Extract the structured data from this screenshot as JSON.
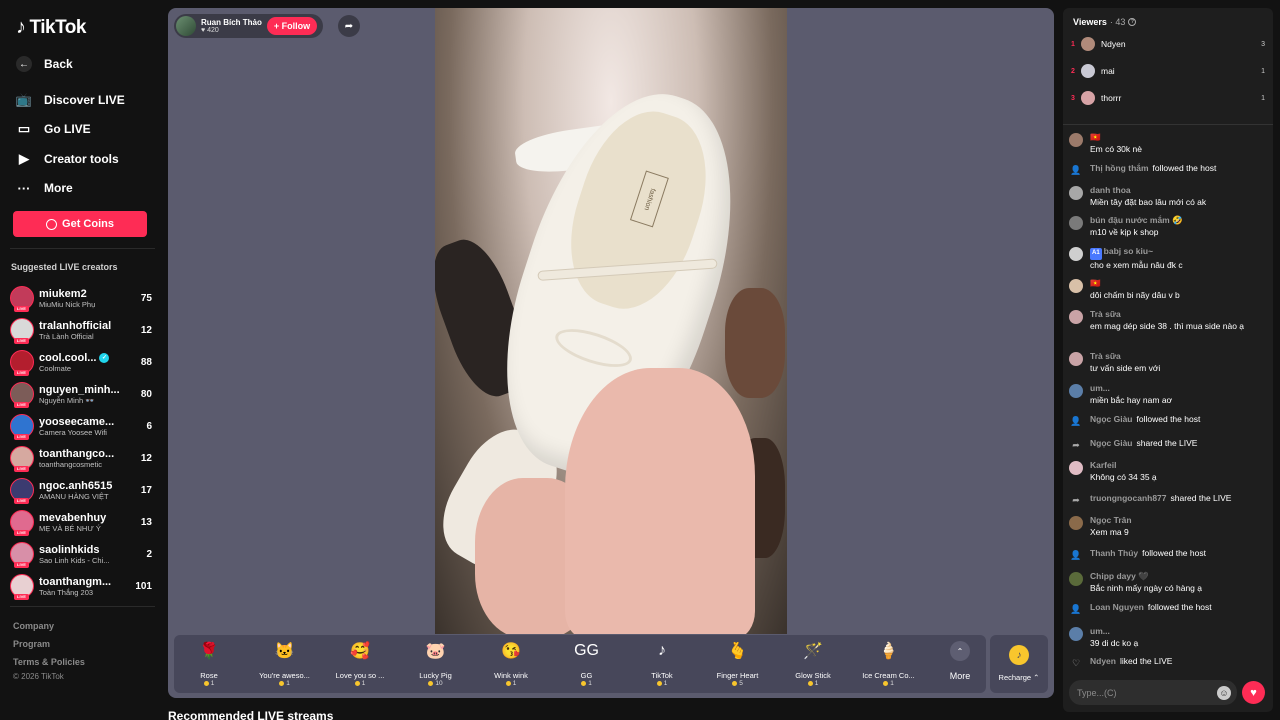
{
  "brand": {
    "logo_text": "TikTok"
  },
  "nav": {
    "back": "Back",
    "discover": "Discover LIVE",
    "go_live": "Go LIVE",
    "creator_tools": "Creator tools",
    "more": "More",
    "get_coins": "Get Coins"
  },
  "suggested": {
    "title": "Suggested LIVE creators",
    "creators": [
      {
        "name": "miukem2",
        "sub": "MiuMiu Nick Phụ",
        "count": "75",
        "color": "#c23b5a"
      },
      {
        "name": "tralanhofficial",
        "sub": "Trà Lành Official",
        "count": "12",
        "color": "#d9d9d9"
      },
      {
        "name": "cool.cool...",
        "sub": "Coolmate",
        "count": "88",
        "color": "#b31e2e",
        "verified": true
      },
      {
        "name": "nguyen_minh...",
        "sub": "Nguyễn Minh 👓",
        "count": "80",
        "color": "#7c5c58"
      },
      {
        "name": "yooseecame...",
        "sub": "Camera Yoosee Wifi",
        "count": "6",
        "color": "#2f74d0"
      },
      {
        "name": "toanthangco...",
        "sub": "toanthangcosmetic",
        "count": "12",
        "color": "#d6a9a0"
      },
      {
        "name": "ngoc.anh6515",
        "sub": "AMANU HÀNG VIỆT",
        "count": "17",
        "color": "#3b3b70"
      },
      {
        "name": "mevabenhuy",
        "sub": "MẸ VÀ BÉ NHƯ Ý",
        "count": "13",
        "color": "#e06a8f"
      },
      {
        "name": "saolinhkids",
        "sub": "Sao Linh Kids - Chi...",
        "count": "2",
        "color": "#d88fa8"
      },
      {
        "name": "toanthangm...",
        "sub": "Toàn Thắng 203",
        "count": "101",
        "color": "#e8d0d2"
      }
    ]
  },
  "footer": {
    "company": "Company",
    "program": "Program",
    "terms": "Terms & Policies",
    "copyright": "© 2026 TikTok"
  },
  "stream": {
    "host_name": "Ruan Bích Thảo",
    "host_likes": "420",
    "follow_label": "+ Follow",
    "brand_on_insole": "fashion"
  },
  "gifts": [
    {
      "name": "Rose",
      "price": "1",
      "icon": "🌹"
    },
    {
      "name": "You're aweso...",
      "price": "1",
      "icon": "🐱"
    },
    {
      "name": "Love you so ...",
      "price": "1",
      "icon": "🥰"
    },
    {
      "name": "Lucky Pig",
      "price": "10",
      "icon": "🐷"
    },
    {
      "name": "Wink wink",
      "price": "1",
      "icon": "😘"
    },
    {
      "name": "GG",
      "price": "1",
      "icon": "GG"
    },
    {
      "name": "TikTok",
      "price": "1",
      "icon": "♪"
    },
    {
      "name": "Finger Heart",
      "price": "5",
      "icon": "🫰"
    },
    {
      "name": "Glow Stick",
      "price": "1",
      "icon": "🪄"
    },
    {
      "name": "Ice Cream Co...",
      "price": "1",
      "icon": "🍦"
    }
  ],
  "gift_more": "More",
  "recharge": "Recharge",
  "recommended_title": "Recommended LIVE streams",
  "viewers": {
    "title": "Viewers",
    "count": "· 43",
    "top": [
      {
        "rank": "1",
        "name": "Ndyen",
        "score": "3",
        "color": "#b08a7a"
      },
      {
        "rank": "2",
        "name": "mai",
        "score": "1",
        "color": "#c9c9d4"
      },
      {
        "rank": "3",
        "name": "thorrr",
        "score": "1",
        "color": "#d7a3a6"
      }
    ]
  },
  "messages": [
    {
      "type": "chat",
      "user": "🇻🇳",
      "text": "Em có 30k nè",
      "color": "#9b7a6a"
    },
    {
      "type": "follow",
      "user": "Thị hồng thắm",
      "text": "followed the host"
    },
    {
      "type": "chat",
      "user": "danh thoa",
      "text": "Miền tây đặt bao lâu mới có ak",
      "color": "#a7a7a7"
    },
    {
      "type": "chat",
      "user": "bún đậu nước mắm 🤣",
      "text": "m10 về kịp k shop",
      "color": "#7a7a7a"
    },
    {
      "type": "chat",
      "user": "babj so kiu~",
      "badge": "A1",
      "text": "cho e xem mẫu nâu đk c",
      "color": "#cfcfcf"
    },
    {
      "type": "chat",
      "user": "🇻🇳",
      "text": "dôi chấm bi nãy dâu v b",
      "color": "#d8c0a8"
    },
    {
      "type": "chat",
      "user": "Trà sữa",
      "text": "em mag dép side 38 . thì mua side nào ạ",
      "color": "#c9a3a6"
    },
    {
      "type": "chat",
      "user": "Trà sữa",
      "text": "tư vấn side em với",
      "color": "#c9a3a6"
    },
    {
      "type": "chat",
      "user": "um...",
      "text": "miền bắc hay nam aơ",
      "color": "#5b7ea8"
    },
    {
      "type": "follow",
      "user": "Ngọc Giàu",
      "text": "followed the host"
    },
    {
      "type": "share",
      "user": "Ngọc Giàu",
      "text": "shared the LIVE"
    },
    {
      "type": "chat",
      "user": "Karfeil",
      "text": "Không có 34 35 ạ",
      "color": "#e0bcc4"
    },
    {
      "type": "share",
      "user": "truongngocanh877",
      "text": "shared the LIVE"
    },
    {
      "type": "chat",
      "user": "Ngọc Trân",
      "text": "Xem ma 9",
      "color": "#8a6a4a"
    },
    {
      "type": "follow",
      "user": "Thanh Thúy",
      "text": "followed the host"
    },
    {
      "type": "chat",
      "user": "Chipp dayy 🖤",
      "text": "Bắc ninh mấy ngày có hàng ạ",
      "color": "#5a6a3a"
    },
    {
      "type": "follow",
      "user": "Loan Nguyen",
      "text": "followed the host"
    },
    {
      "type": "chat",
      "user": "um...",
      "text": "39 di dc ko ạ",
      "color": "#5b7ea8"
    },
    {
      "type": "like",
      "user": "Ndyen",
      "text": "liked the LIVE"
    }
  ],
  "chat_input": {
    "placeholder": "Type...(C)"
  }
}
